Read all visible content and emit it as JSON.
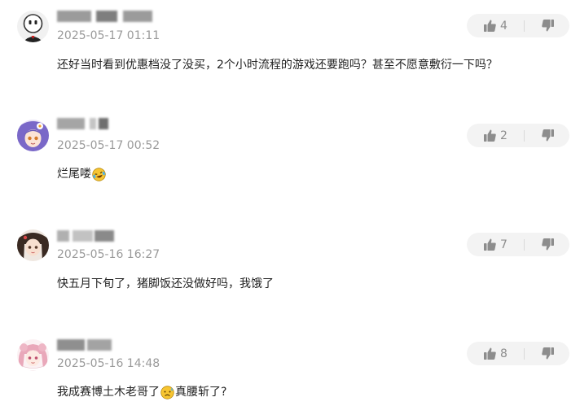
{
  "comments": [
    {
      "username": "",
      "date": "2025-05-17 01:11",
      "text": "还好当时看到优惠档没了没买，2个小时流程的游戏还要跑吗？甚至不愿意敷衍一下吗？",
      "likes": "4",
      "avatar_icon": "cartoon-face-avatar-icon"
    },
    {
      "username": "",
      "date": "2025-05-17 00:52",
      "text": "烂尾喽",
      "likes": "2",
      "avatar_icon": "anime-girl-purple-hair-avatar-icon",
      "emoji": "laughing-tears-emoji"
    },
    {
      "username": "",
      "date": "2025-05-16 16:27",
      "text": "快五月下旬了，猪脚饭还没做好吗，我饿了",
      "likes": "7",
      "avatar_icon": "anime-girl-dark-hair-avatar-icon"
    },
    {
      "username": "",
      "date": "2025-05-16 14:48",
      "text_before": "我成赛博土木老哥了",
      "text_after": "真腰斩了?",
      "likes": "8",
      "avatar_icon": "anime-girl-pink-hair-avatar-icon",
      "emoji": "sad-sweat-emoji"
    }
  ],
  "colors": {
    "date": "#9a9a9a",
    "text": "#222222",
    "pill_bg": "#f3f3f3",
    "icon": "#8d8d8d"
  }
}
